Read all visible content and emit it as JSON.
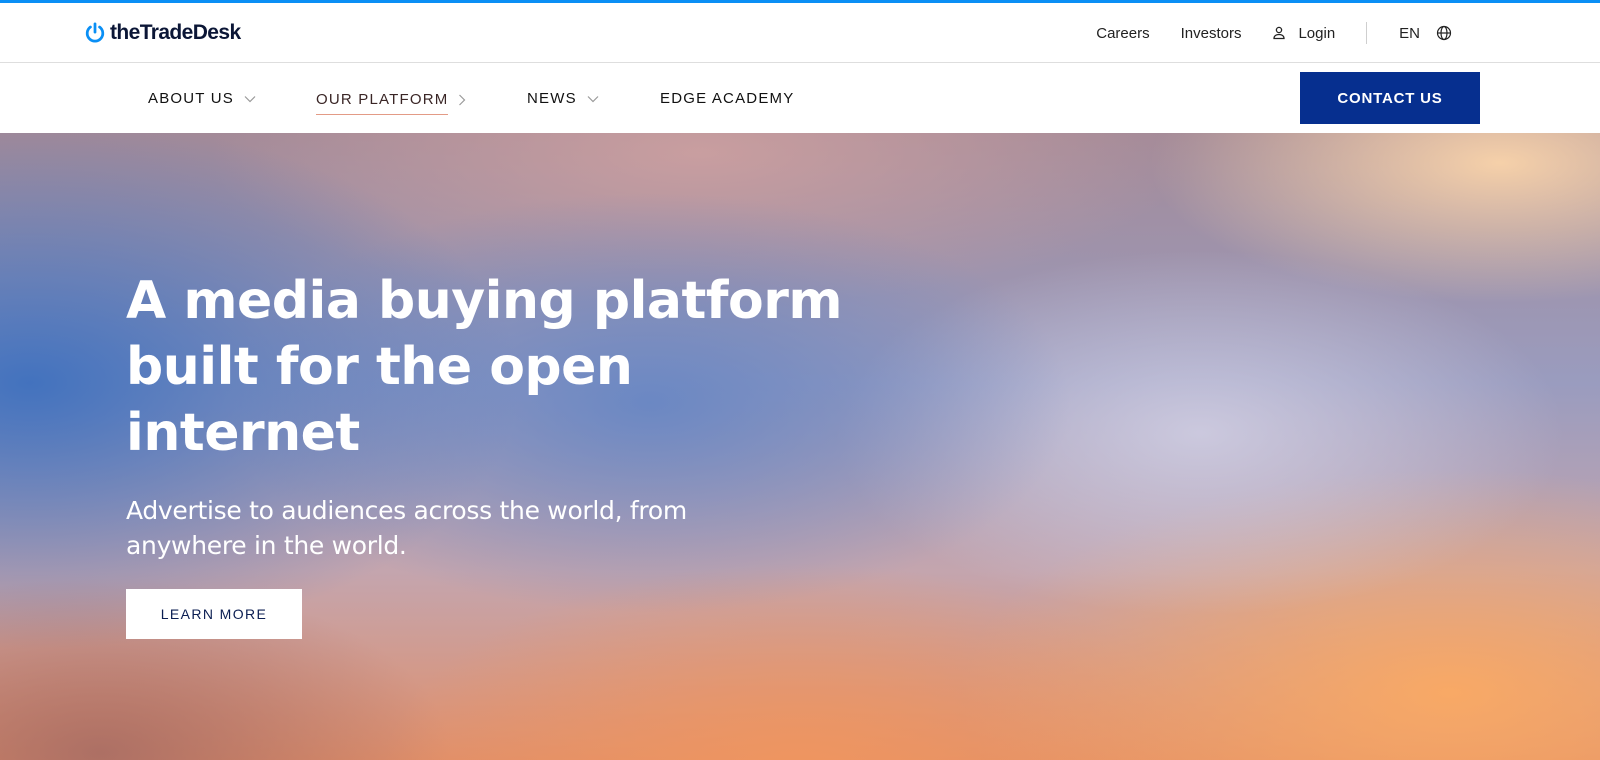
{
  "brand": {
    "logo_text": "theTradeDesk",
    "accent_color": "#0a8ff5",
    "primary_button_color": "#062f8f"
  },
  "utility_nav": {
    "careers": "Careers",
    "investors": "Investors",
    "login": "Login",
    "language": "EN",
    "icons": [
      "person-icon",
      "globe-icon"
    ]
  },
  "main_nav": {
    "items": [
      {
        "label": "ABOUT US",
        "icon": "chevron-down-icon"
      },
      {
        "label": "OUR PLATFORM",
        "icon": "chevron-right-icon",
        "active": true
      },
      {
        "label": "NEWS",
        "icon": "chevron-down-icon"
      },
      {
        "label": "EDGE ACADEMY"
      }
    ],
    "contact_label": "CONTACT US"
  },
  "hero": {
    "title": "A media buying platform built for the open internet",
    "subtitle": "Advertise to audiences across the world, from anywhere in the world.",
    "cta_label": "LEARN MORE"
  }
}
